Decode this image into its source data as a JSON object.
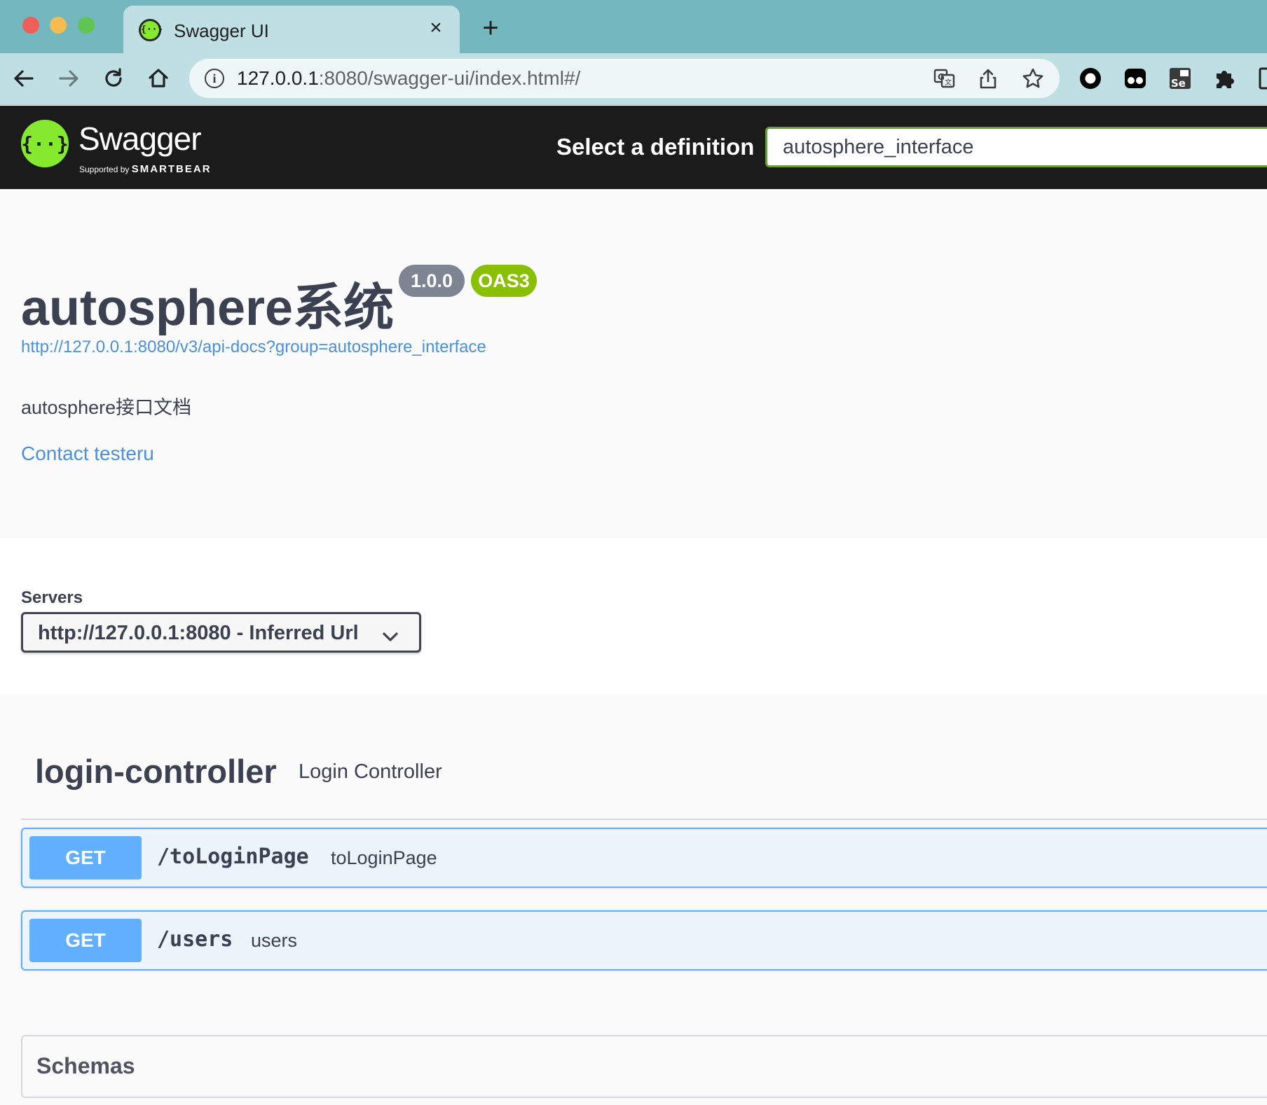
{
  "browser": {
    "tab_title": "Swagger UI",
    "tab_close": "×",
    "new_tab": "+",
    "url_host": "127.0.0.1",
    "url_rest": ":8080/swagger-ui/index.html#/",
    "info": "i",
    "extension_label": "Se"
  },
  "topbar": {
    "logo_text": "Swagger",
    "logo_supported": "Supported by",
    "logo_brand": "SMARTBEAR",
    "select_label": "Select a definition",
    "selected_definition": "autosphere_interface"
  },
  "info": {
    "title": "autosphere系统",
    "version": "1.0.0",
    "oas": "OAS3",
    "spec_url": "http://127.0.0.1:8080/v3/api-docs?group=autosphere_interface",
    "description": "autosphere接口文档",
    "contact": "Contact testeru"
  },
  "servers": {
    "label": "Servers",
    "selected": "http://127.0.0.1:8080 - Inferred Url"
  },
  "tag": {
    "name": "login-controller",
    "description": "Login Controller"
  },
  "operations": [
    {
      "method": "GET",
      "path": "/toLoginPage",
      "summary": "toLoginPage"
    },
    {
      "method": "GET",
      "path": "/users",
      "summary": "users"
    }
  ],
  "models": {
    "title": "Schemas"
  },
  "colors": {
    "accent_green": "#85ea2d",
    "get_blue": "#61affe",
    "link_blue": "#4990e2",
    "badge_grey": "#7d8492",
    "badge_green": "#89bf04",
    "topbar_bg": "#1b1b1b",
    "tabbar_bg": "#75b7bf"
  },
  "icons": [
    "swagger-logo-icon",
    "back-icon",
    "forward-icon",
    "reload-icon",
    "home-icon",
    "info-icon",
    "translate-icon",
    "share-icon",
    "star-icon",
    "record-icon",
    "extension-glasses-icon",
    "selenium-icon",
    "puzzle-icon",
    "chevron-down-icon"
  ]
}
